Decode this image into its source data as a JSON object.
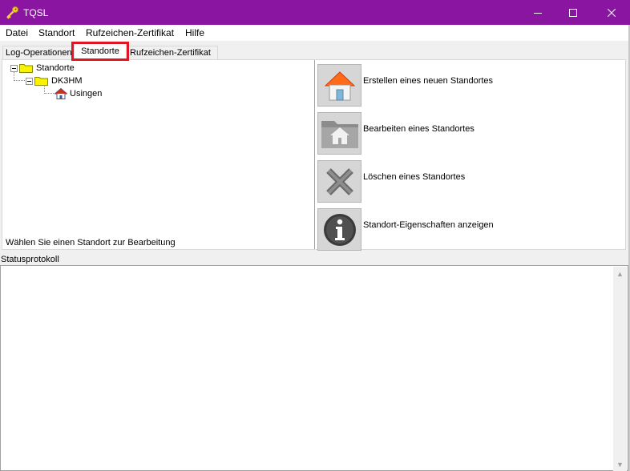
{
  "window": {
    "title": "TQSL",
    "titlebar_color": "#8a15a0"
  },
  "menu": {
    "items": [
      "Datei",
      "Standort",
      "Rufzeichen-Zertifikat",
      "Hilfe"
    ]
  },
  "tabs": [
    {
      "label": "Log-Operationen",
      "selected": false
    },
    {
      "label": "Standorte",
      "selected": true
    },
    {
      "label": "Rufzeichen-Zertifikat",
      "selected": false
    }
  ],
  "highlight_color": "#e01624",
  "tree": {
    "root": "Standorte",
    "callsign": "DK3HM",
    "location": "Usingen",
    "hint": "Wählen Sie einen Standort zur Bearbeitung"
  },
  "actions": [
    {
      "label": "Erstellen eines neuen Standortes",
      "icon": "house-add-icon"
    },
    {
      "label": "Bearbeiten eines Standortes",
      "icon": "folder-house-icon"
    },
    {
      "label": "Löschen eines Standortes",
      "icon": "delete-x-icon"
    },
    {
      "label": "Standort-Eigenschaften anzeigen",
      "icon": "info-icon"
    }
  ],
  "status": {
    "label": "Statusprotokoll",
    "content": ""
  }
}
